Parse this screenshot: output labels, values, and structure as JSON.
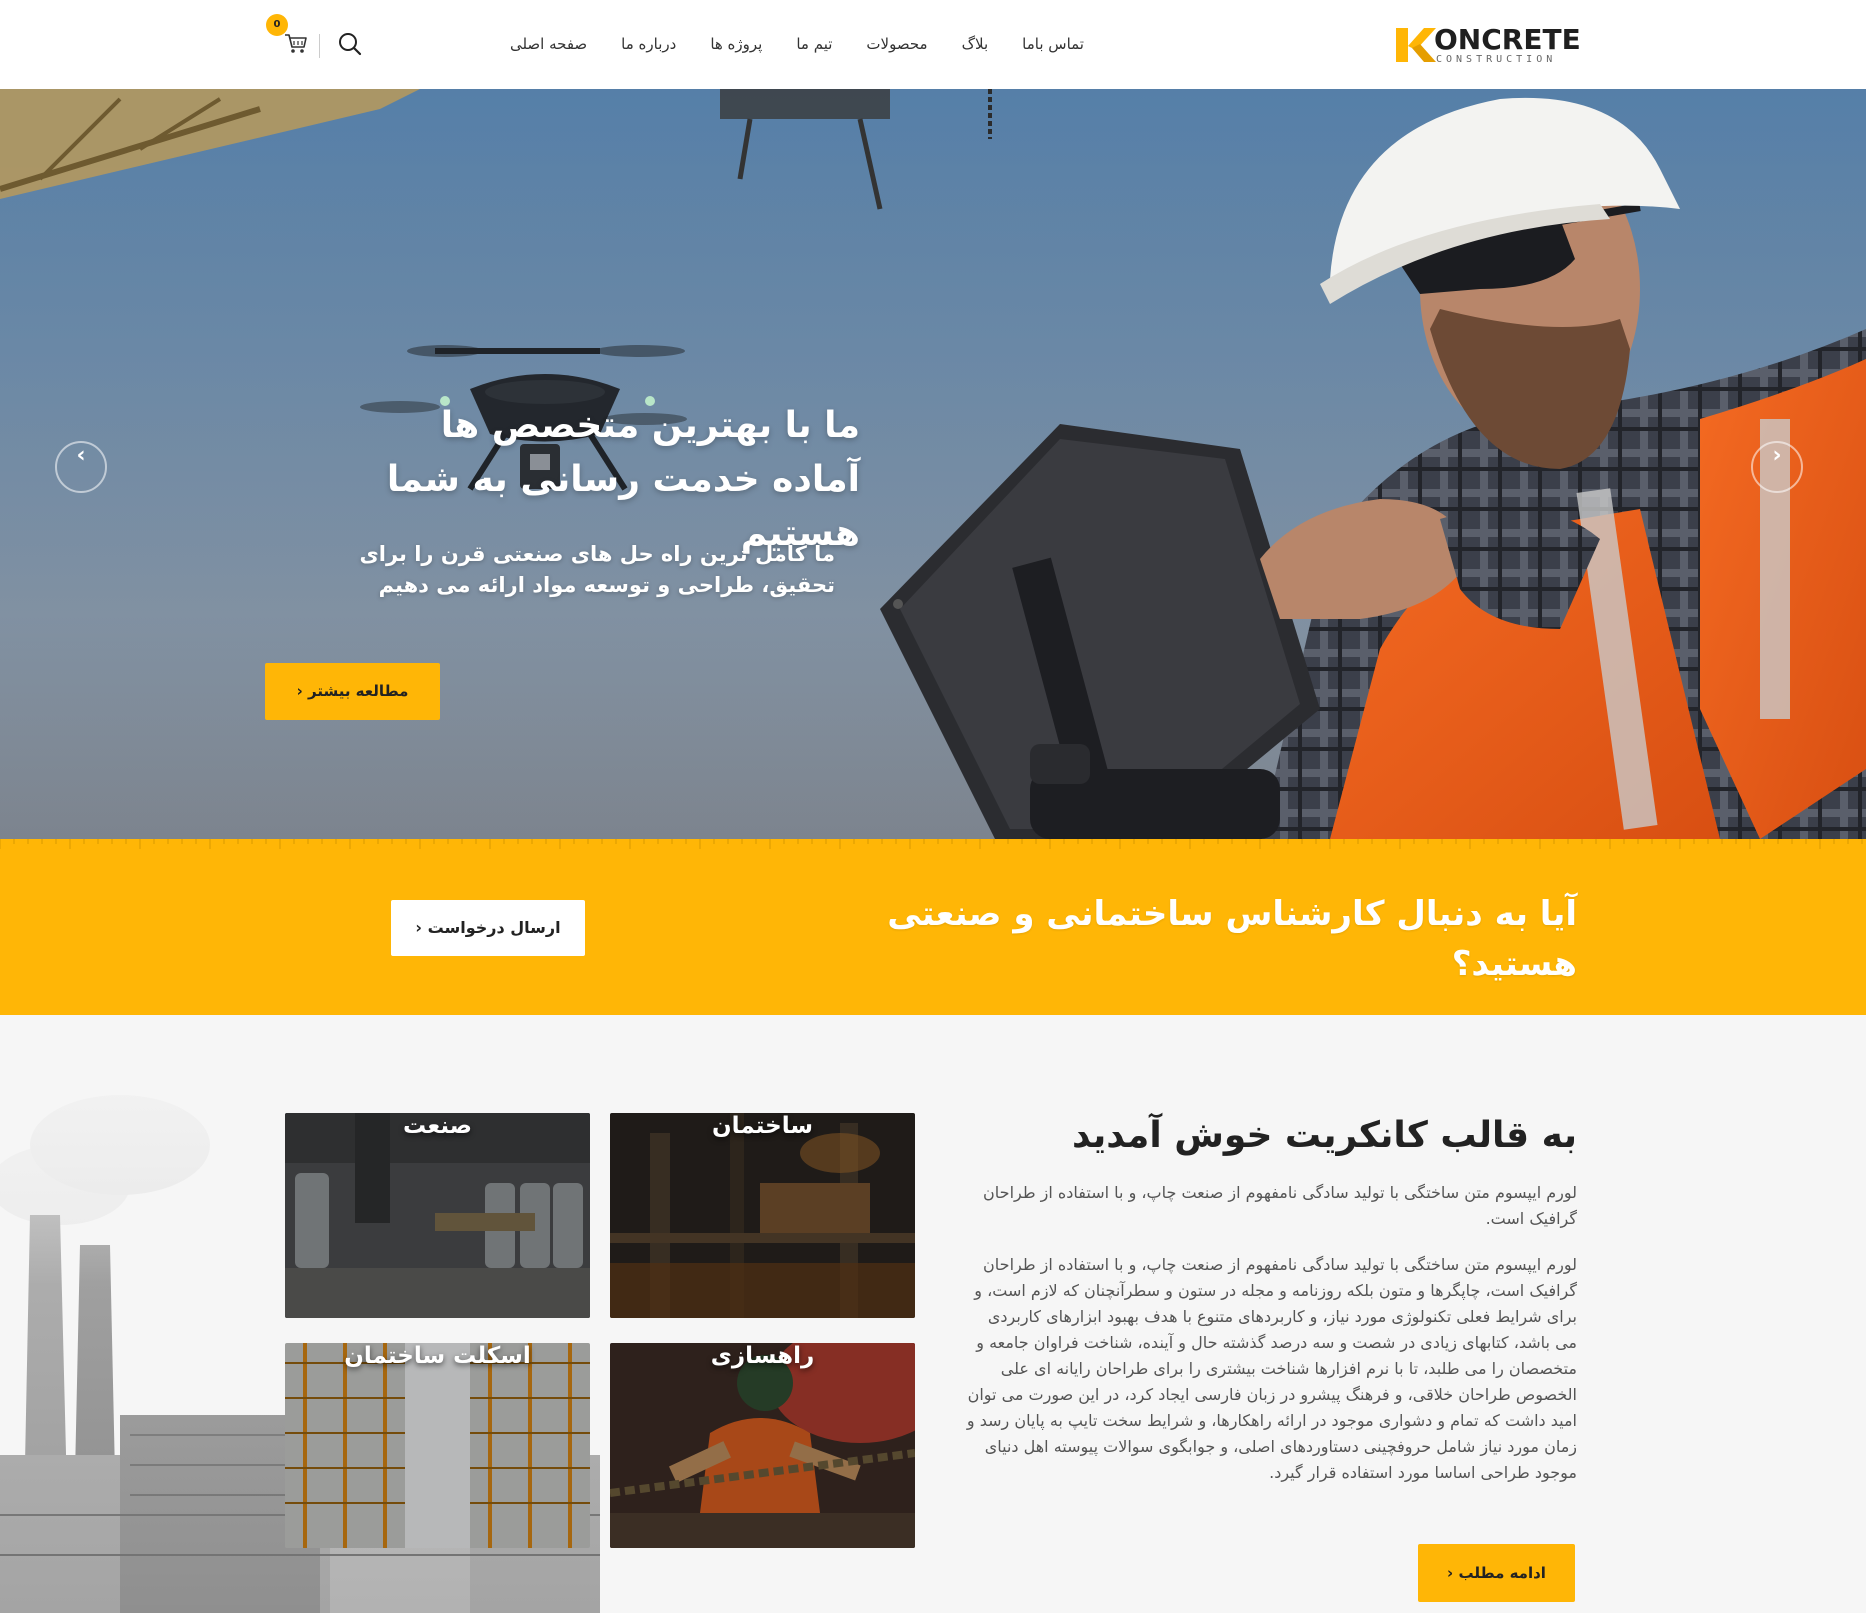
{
  "brand": {
    "logo_main": "ONCRETE",
    "logo_sub": "CONSTRUCTION",
    "accent_color": "#ffb606"
  },
  "nav": {
    "items": [
      "صفحه اصلی",
      "درباره ما",
      "پروژه ها",
      "تیم ما",
      "محصولات",
      "بلاگ",
      "تماس باما"
    ]
  },
  "header": {
    "search_icon": "search-icon",
    "cart_icon": "cart-icon",
    "cart_count": "0"
  },
  "hero": {
    "title_line1": "ما با بهترین متخصص ها",
    "title_line2": "آماده خدمت رسانی به شما هستیم",
    "subtitle_line1": "ما کامل ترین راه حل های صنعتی قرن را برای",
    "subtitle_line2": "تحقیق، طراحی و توسعه مواد ارائه می دهیم",
    "button_label": "مطالعه بیشتر",
    "button_chevron": "‹",
    "prev_icon": "chevron-left-icon",
    "next_icon": "chevron-right-icon"
  },
  "cta": {
    "text": "آیا به دنبال کارشناس ساختمانی و صنعتی هستید؟",
    "button_label": "ارسال درخواست",
    "button_chevron": "‹"
  },
  "welcome": {
    "title": "به قالب کانکریت خوش آمدید",
    "paragraph1": "لورم ایپسوم متن ساختگی با تولید سادگی نامفهوم از صنعت چاپ، و با استفاده از طراحان گرافیک است.",
    "paragraph2": "لورم ایپسوم متن ساختگی با تولید سادگی نامفهوم از صنعت چاپ، و با استفاده از طراحان گرافیک است، چاپگرها و متون بلکه روزنامه و مجله در ستون و سطرآنچنان که لازم است، و برای شرایط فعلی تکنولوژی مورد نیاز، و کاربردهای متنوع با هدف بهبود ابزارهای کاربردی می باشد، کتابهای زیادی در شصت و سه درصد گذشته حال و آینده، شناخت فراوان جامعه و متخصصان را می طلبد، تا با نرم افزارها شناخت بیشتری را برای طراحان رایانه ای علی الخصوص طراحان خلاقی، و فرهنگ پیشرو در زبان فارسی ایجاد کرد، در این صورت می توان امید داشت که تمام و دشواری موجود در ارائه راهکارها، و شرایط سخت تایپ به پایان رسد و زمان مورد نیاز شامل حروفچینی دستاوردهای اصلی، و جوابگوی سوالات پیوسته اهل دنیای موجود طراحی اساسا مورد استفاده قرار گیرد.",
    "button_label": "ادامه مطلب",
    "button_chevron": "‹"
  },
  "services": {
    "tiles": [
      {
        "label": "ساختمان"
      },
      {
        "label": "صنعت"
      },
      {
        "label": "راهسازی"
      },
      {
        "label": "اسکلت ساختمان"
      }
    ]
  }
}
